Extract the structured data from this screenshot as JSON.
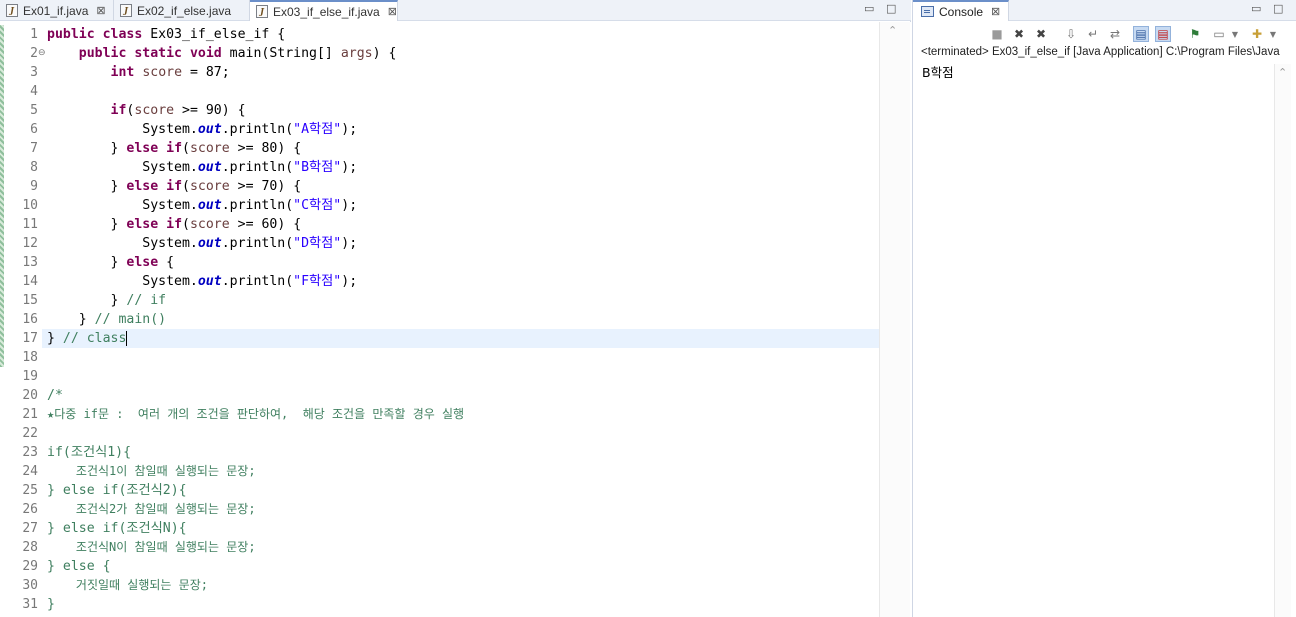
{
  "editor": {
    "tabs": [
      {
        "label": "Ex01_if.java",
        "active": false,
        "closable": true
      },
      {
        "label": "Ex02_if_else.java",
        "active": false,
        "closable": false
      },
      {
        "label": "Ex03_if_else_if.java",
        "active": true,
        "closable": true
      }
    ],
    "line_numbers": [
      "1",
      "2",
      "3",
      "4",
      "5",
      "6",
      "7",
      "8",
      "9",
      "10",
      "11",
      "12",
      "13",
      "14",
      "15",
      "16",
      "17",
      "18",
      "19",
      "20",
      "21",
      "22",
      "23",
      "24",
      "25",
      "26",
      "27",
      "28",
      "29",
      "30",
      "31"
    ],
    "code": {
      "l1": {
        "kw1": "public",
        "kw2": "class",
        "rest": " Ex03_if_else_if {"
      },
      "l2": {
        "kw1": "public",
        "kw2": "static",
        "kw3": "void",
        "rest1": " main(String[] ",
        "var": "args",
        "rest2": ") {"
      },
      "l3": {
        "kw": "int",
        "var": "score",
        "rest": " = 87;"
      },
      "l5": {
        "kw": "if",
        "p1": "(",
        "var": "score",
        "rest": " >= 90) {"
      },
      "l6": {
        "p1": "System.",
        "fld": "out",
        "p2": ".println(",
        "str": "\"A학점\"",
        "p3": ");"
      },
      "l7": {
        "p1": "} ",
        "kw1": "else",
        "kw2": "if",
        "p2": "(",
        "var": "score",
        "rest": " >= 80) {"
      },
      "l8": {
        "p1": "System.",
        "fld": "out",
        "p2": ".println(",
        "str": "\"B학점\"",
        "p3": ");"
      },
      "l9": {
        "p1": "} ",
        "kw1": "else",
        "kw2": "if",
        "p2": "(",
        "var": "score",
        "rest": " >= 70) {"
      },
      "l10": {
        "p1": "System.",
        "fld": "out",
        "p2": ".println(",
        "str": "\"C학점\"",
        "p3": ");"
      },
      "l11": {
        "p1": "} ",
        "kw1": "else",
        "kw2": "if",
        "p2": "(",
        "var": "score",
        "rest": " >= 60) {"
      },
      "l12": {
        "p1": "System.",
        "fld": "out",
        "p2": ".println(",
        "str": "\"D학점\"",
        "p3": ");"
      },
      "l13": {
        "p1": "} ",
        "kw1": "else",
        "rest": " {"
      },
      "l14": {
        "p1": "System.",
        "fld": "out",
        "p2": ".println(",
        "str": "\"F학점\"",
        "p3": ");"
      },
      "l15": {
        "p1": "} ",
        "cmt": "// if"
      },
      "l16": {
        "p1": "} ",
        "cmt": "// main()"
      },
      "l17": {
        "p1": "} ",
        "cmt": "// class"
      },
      "l19": "/*",
      "l20": "★다중 if문 :  여러 개의 조건을 판단하여,  해당 조건을 만족할 경우 실행",
      "l22": "if(조건식1){",
      "l23": "    조건식1이 참일때 실행되는 문장;",
      "l24": "} else if(조건식2){",
      "l25": "    조건식2가 참일때 실행되는 문장;",
      "l26": "} else if(조건식N){",
      "l27": "    조건식N이 참일때 실행되는 문장;",
      "l28": "} else {",
      "l29": "    거짓일때 실행되는 문장;",
      "l30": "}",
      "l31": "*/"
    }
  },
  "console": {
    "tab_label": "Console",
    "header": "<terminated> Ex03_if_else_if [Java Application] C:\\Program Files\\Java",
    "output": "B학점"
  },
  "icons": {
    "editor_tab_icon": "java-file-icon",
    "close": "close-icon",
    "minimize": "minimize-icon",
    "maximize": "maximize-icon",
    "console_tab_icon": "console-icon",
    "toolbar": [
      "terminate-icon",
      "remove-launch-icon",
      "remove-all-terminated-icon",
      "scroll-lock-icon",
      "word-wrap-icon",
      "show-on-output-icon",
      "show-on-error-icon",
      "pin-console-icon",
      "display-selected-console-icon",
      "open-console-icon"
    ]
  }
}
